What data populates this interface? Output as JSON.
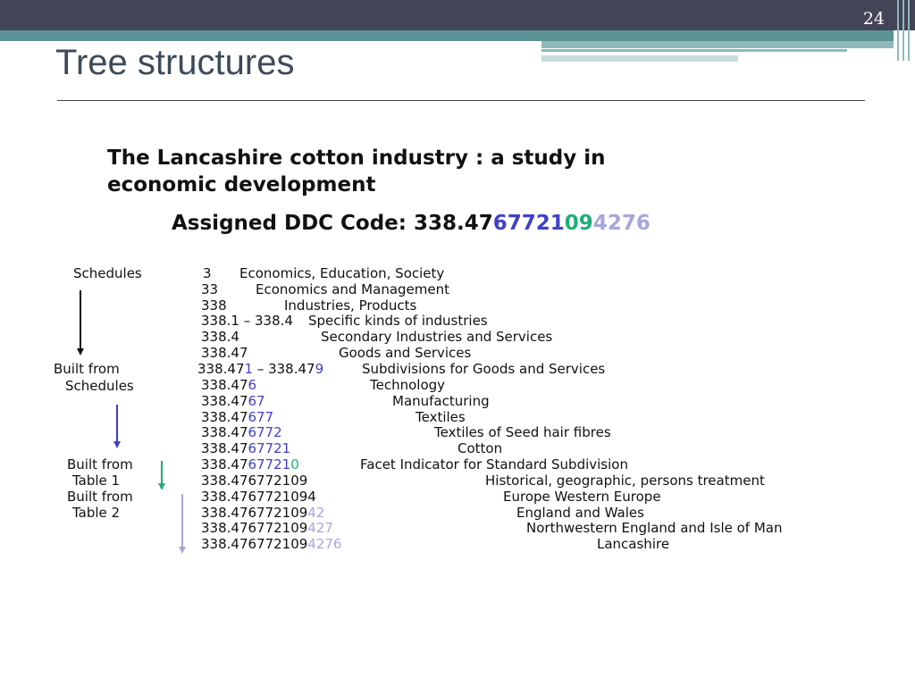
{
  "slide": {
    "number": "24",
    "title": "Tree structures"
  },
  "book_title": {
    "line1": "The Lancashire cotton industry : a study in",
    "line2": "economic development"
  },
  "ddc": {
    "label": "Assigned DDC Code: ",
    "p1": "338.47",
    "p2": "67721",
    "p3": "09",
    "p4": "4276"
  },
  "side_labels": {
    "schedules": "Schedules",
    "built_from_schedules_1": "Built  from",
    "built_from_schedules_2": "Schedules",
    "built_from_table1_1": "Built from",
    "built_from_table1_2": "Table 1",
    "built_from_table2_1": "Built from",
    "built_from_table2_2": "Table 2"
  },
  "rows": [
    {
      "base": "3",
      "ext": "",
      "desc": "Economics, Education, Society"
    },
    {
      "base": "33",
      "ext": "",
      "desc": "Economics and Management"
    },
    {
      "base": "338",
      "ext": "",
      "desc": "Industries, Products"
    },
    {
      "base": "338.1 – 338.4",
      "ext": "",
      "desc": "Specific kinds of industries"
    },
    {
      "base": "338.4",
      "ext": "",
      "desc": "Secondary Industries and Services"
    },
    {
      "base": "338.47",
      "ext": "",
      "desc": "Goods and Services"
    },
    {
      "base": "338.47",
      "ext": "1",
      "mid": " – 338.47",
      "ext2": "9",
      "desc": "Subdivisions for Goods and Services"
    },
    {
      "base": "338.47",
      "ext": "6",
      "desc": "Technology"
    },
    {
      "base": "338.47",
      "ext": "67",
      "desc": "Manufacturing"
    },
    {
      "base": "338.47",
      "ext": "677",
      "desc": "Textiles"
    },
    {
      "base": "338.47",
      "ext": "6772",
      "desc": "Textiles of Seed hair fibres"
    },
    {
      "base": "338.47",
      "ext": "67721",
      "desc": "Cotton"
    },
    {
      "base": "338.47",
      "ext": "67721",
      "ext_g": "0",
      "desc": "Facet Indicator for Standard Subdivision"
    },
    {
      "base": "338.476772109",
      "desc": "Historical, geographic, persons treatment"
    },
    {
      "base": "338.4767721094",
      "desc": "Europe    Western Europe"
    },
    {
      "base": "338.476772109",
      "ext_l": "42",
      "desc": "England and Wales"
    },
    {
      "base": "338.476772109",
      "ext_l": "427",
      "desc": "Northwestern England and Isle of Man"
    },
    {
      "base": "338.476772109",
      "ext_l": "4276",
      "desc": "Lancashire"
    }
  ],
  "colors": {
    "blue": "#4040c8",
    "green": "#1fae7a",
    "lavender": "#a6a6dc"
  }
}
